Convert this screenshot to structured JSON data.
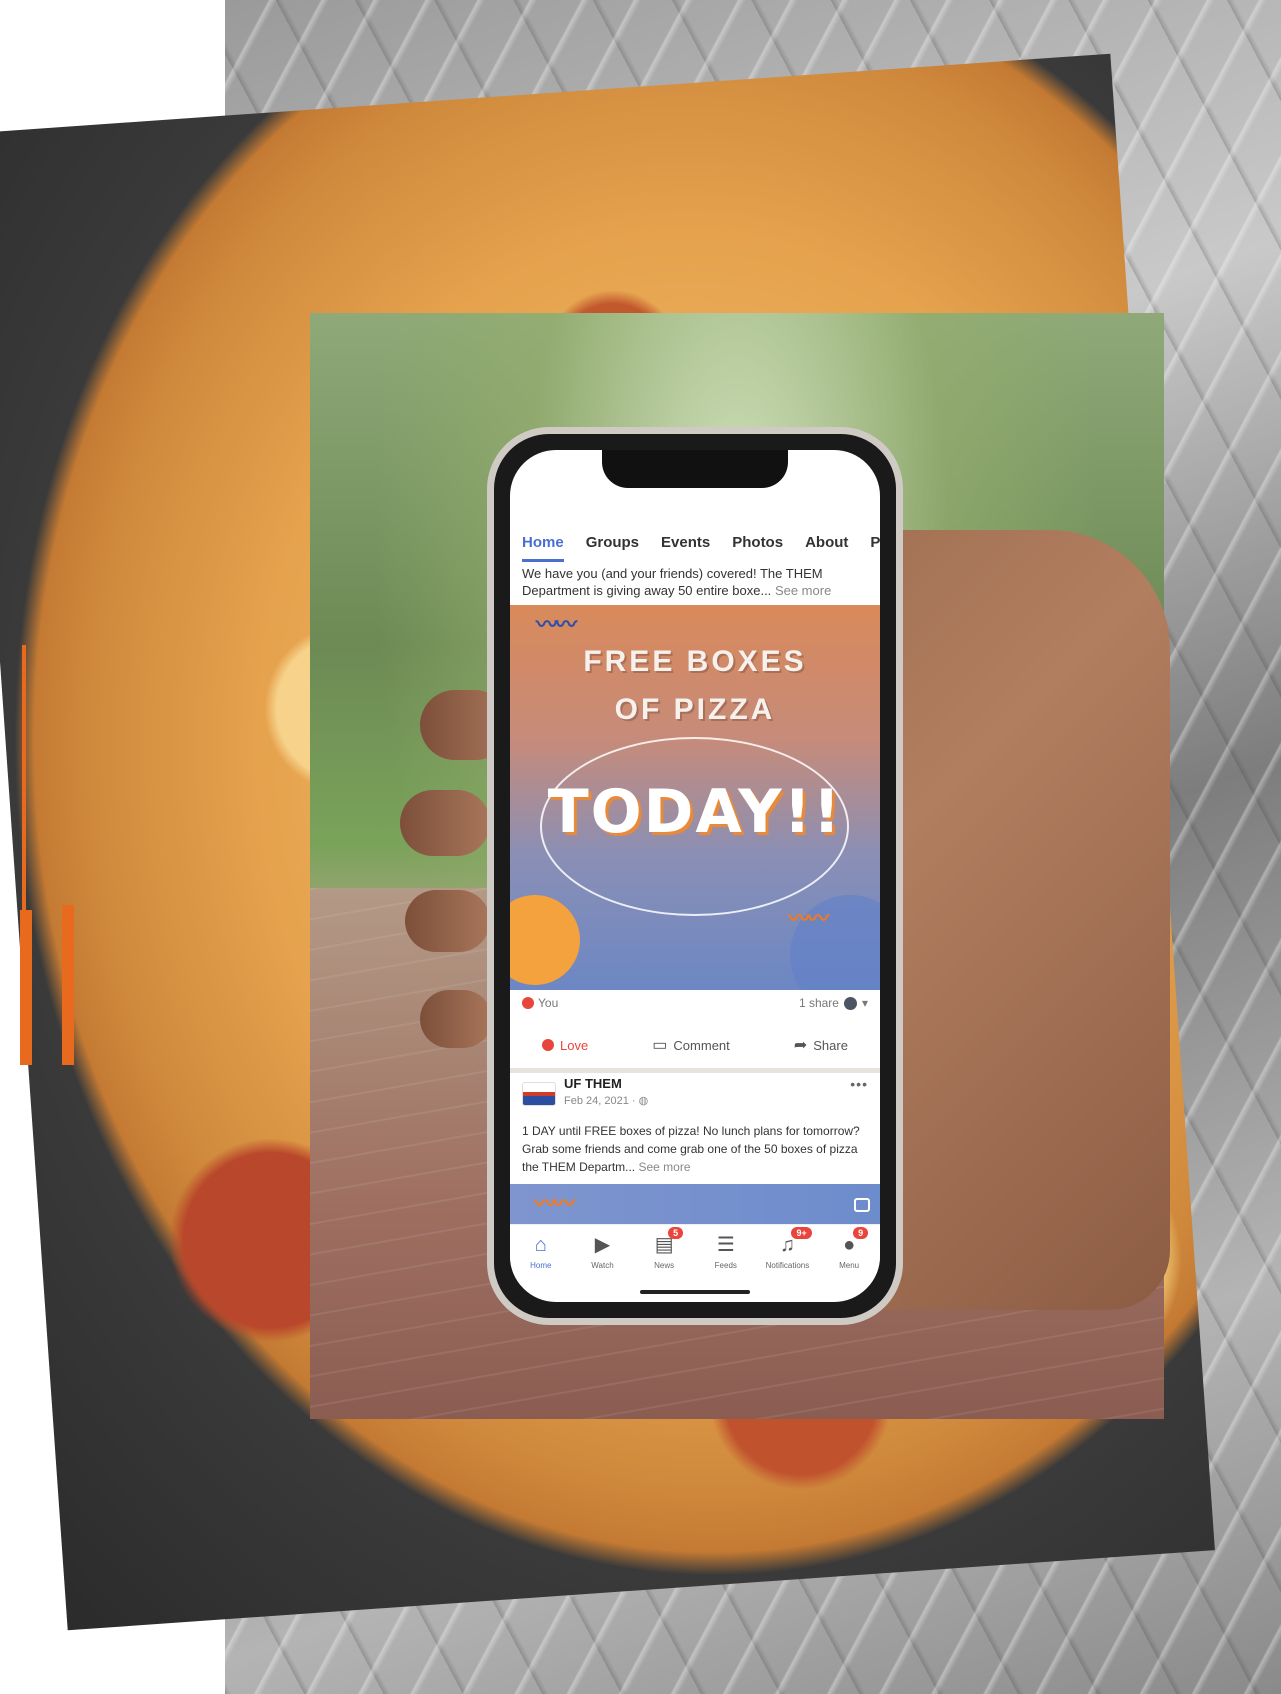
{
  "tabs": {
    "home": "Home",
    "groups": "Groups",
    "events": "Events",
    "photos": "Photos",
    "about": "About",
    "cutoff": "Po"
  },
  "post1": {
    "text": "We have you (and your friends) covered! The THEM Department is giving away 50 entire boxe...",
    "see_more": "See more",
    "image": {
      "line1": "FREE BOXES",
      "line2": "OF PIZZA",
      "line3": "TODAY!!"
    },
    "reaction_user": "You",
    "shares": "1 share",
    "actions": {
      "love": "Love",
      "comment": "Comment",
      "share": "Share"
    }
  },
  "post2": {
    "page_name": "UF THEM",
    "date": "Feb 24, 2021 · ",
    "text": "1 DAY until FREE boxes of pizza! No lunch plans for tomorrow? Grab some friends and come grab one of the 50 boxes of pizza the THEM Departm...",
    "see_more": "See more"
  },
  "nav": {
    "home": "Home",
    "watch": "Watch",
    "news": "News",
    "feeds": "Feeds",
    "notifications": "Notifications",
    "menu": "Menu",
    "news_badge": "5",
    "notifications_badge": "9+",
    "menu_badge": "9"
  },
  "colors": {
    "accent_orange": "#e86a1e",
    "facebook_blue": "#4a6fd0",
    "love_red": "#e8453c"
  },
  "icons": [
    "home-icon",
    "watch-icon",
    "news-icon",
    "feeds-icon",
    "bell-icon",
    "menu-avatar-icon",
    "comment-icon",
    "share-icon",
    "heart-icon",
    "globe-icon"
  ]
}
